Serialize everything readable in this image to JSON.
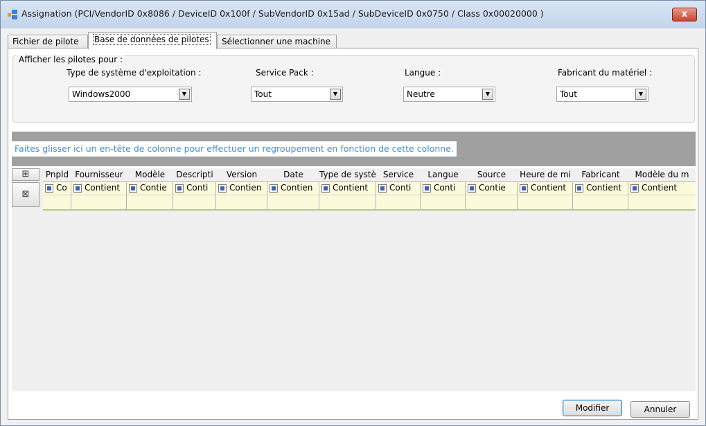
{
  "window": {
    "title": "Assignation (PCI/VendorID 0x8086 / DeviceID 0x100f / SubVendorID 0x15ad / SubDeviceID 0x0750 / Class 0x00020000 )",
    "close_label": "x"
  },
  "tabs": [
    {
      "label": "Fichier de pilote"
    },
    {
      "label": "Base de données de pilotes"
    },
    {
      "label": "Sélectionner une machine"
    }
  ],
  "filters": {
    "group_label": "Afficher les pilotes pour :",
    "os": {
      "label": "Type de système d'exploitation :",
      "value": "Windows2000"
    },
    "service_pack": {
      "label": "Service Pack :",
      "value": "Tout"
    },
    "language": {
      "label": "Langue :",
      "value": "Neutre"
    },
    "manufacturer": {
      "label": "Fabricant du matériel :",
      "value": "Tout"
    }
  },
  "group_by_hint": "Faites glisser ici un en-tête de colonne pour effectuer un regroupement en fonction de cette colonne.",
  "grid": {
    "columns": [
      {
        "label": "Pnpld",
        "filter": "Co"
      },
      {
        "label": "Fournisseur",
        "filter": "Contient"
      },
      {
        "label": "Modèle",
        "filter": "Contie"
      },
      {
        "label": "Descripti",
        "filter": "Conti"
      },
      {
        "label": "Version",
        "filter": "Contien"
      },
      {
        "label": "Date",
        "filter": "Contien"
      },
      {
        "label": "Type de systè",
        "filter": "Contient"
      },
      {
        "label": "Service",
        "filter": "Conti"
      },
      {
        "label": "Langue",
        "filter": "Conti"
      },
      {
        "label": "Source",
        "filter": "Contie"
      },
      {
        "label": "Heure de mi",
        "filter": "Contient"
      },
      {
        "label": "Fabricant",
        "filter": "Contient"
      },
      {
        "label": "Modèle du m",
        "filter": "Contient"
      }
    ]
  },
  "buttons": {
    "modify": "Modifier",
    "cancel": "Annuler"
  }
}
